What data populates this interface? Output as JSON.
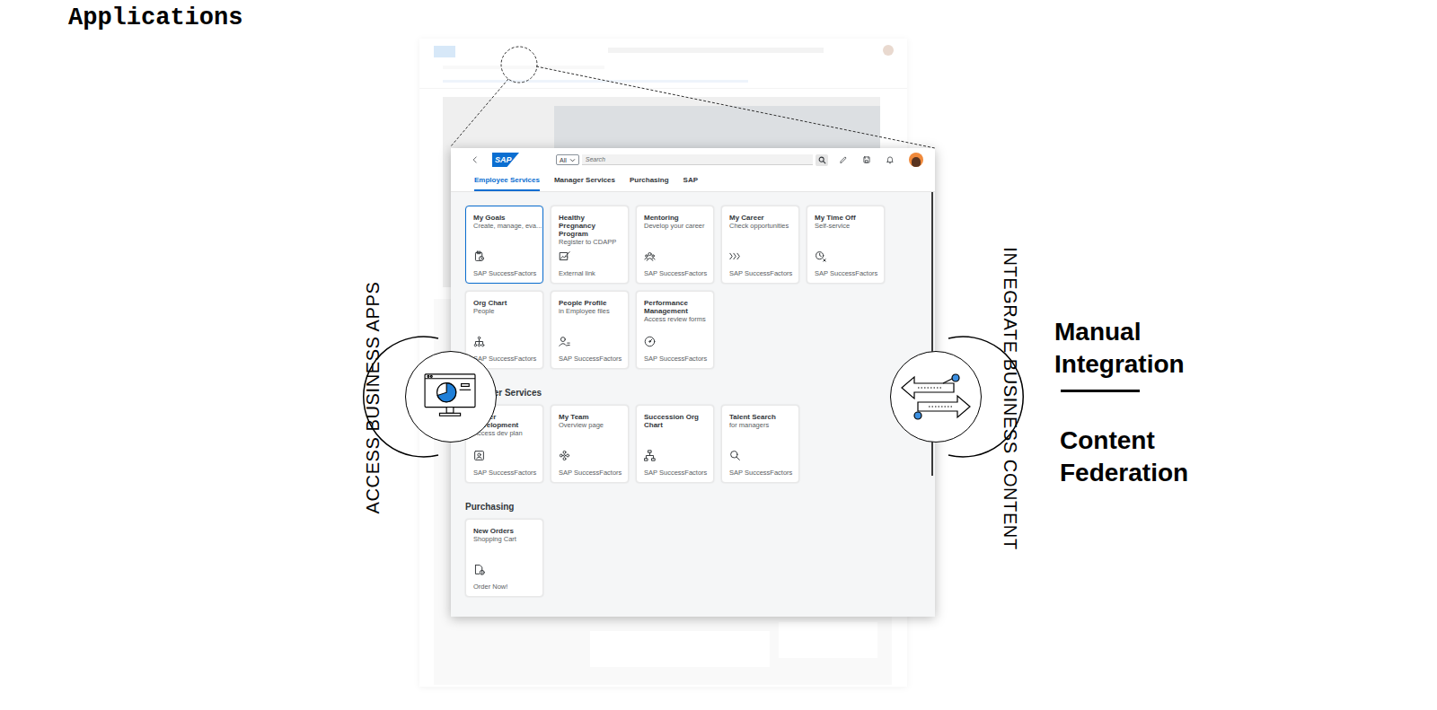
{
  "heading": "Applications",
  "launchpad": {
    "logo": "SAP",
    "search": {
      "scope": "All",
      "placeholder": "Search"
    },
    "tabs": [
      {
        "label": "Employee Services",
        "selected": true
      },
      {
        "label": "Manager Services",
        "selected": false
      },
      {
        "label": "Purchasing",
        "selected": false
      },
      {
        "label": "SAP",
        "selected": false
      }
    ],
    "groups": [
      {
        "cards": [
          {
            "title": "My Goals",
            "subtitle": "Create, manage, eva...",
            "footer": "SAP SuccessFactors",
            "selected": true
          },
          {
            "title": "Healthy Pregnancy Program",
            "subtitle": "Register to CDAPP",
            "footer": "External link",
            "selected": false
          },
          {
            "title": "Mentoring",
            "subtitle": "Develop your career",
            "footer": "SAP SuccessFactors",
            "selected": false
          },
          {
            "title": "My Career",
            "subtitle": "Check opportunities",
            "footer": "SAP SuccessFactors",
            "selected": false
          },
          {
            "title": "My Time Off",
            "subtitle": "Self-service",
            "footer": "SAP SuccessFactors",
            "selected": false
          },
          {
            "title": "Org Chart",
            "subtitle": "People",
            "footer": "SAP SuccessFactors",
            "selected": false
          },
          {
            "title": "People Profile",
            "subtitle": "in Employee files",
            "footer": "SAP SuccessFactors",
            "selected": false
          },
          {
            "title": "Performance Management",
            "subtitle": "Access review forms",
            "footer": "SAP SuccessFactors",
            "selected": false
          }
        ]
      },
      {
        "title": "Manager Services",
        "cards": [
          {
            "title": "Career Development",
            "subtitle": "Access dev plan",
            "footer": "SAP SuccessFactors",
            "selected": false
          },
          {
            "title": "My Team",
            "subtitle": "Overview page",
            "footer": "SAP SuccessFactors",
            "selected": false
          },
          {
            "title": "Succession Org Chart",
            "footer": "SAP SuccessFactors",
            "selected": false
          },
          {
            "title": "Talent Search",
            "subtitle": "for managers",
            "footer": "SAP SuccessFactors",
            "selected": false
          }
        ]
      },
      {
        "title": "Purchasing",
        "cards": [
          {
            "title": "New Orders",
            "subtitle": "Shopping Cart",
            "footer": "Order Now!",
            "selected": false
          }
        ]
      }
    ]
  },
  "callouts": [
    {
      "label": "ACCESS BUSINESS APPS"
    },
    {
      "label": "INTEGRATE BUSINESS CONTENT"
    }
  ],
  "integration_modes": [
    "Manual Integration",
    "Content Federation"
  ]
}
